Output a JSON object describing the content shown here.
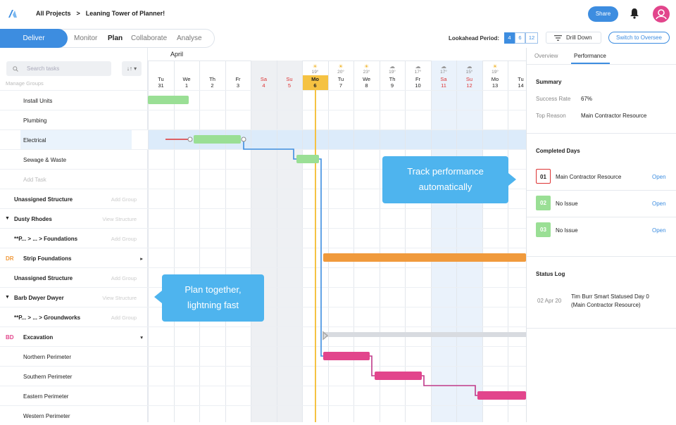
{
  "breadcrumb": {
    "root": "All Projects",
    "sep": ">",
    "project": "Leaning Tower of Planner!"
  },
  "header": {
    "share": "Share",
    "bell_icon": "bell-icon",
    "avatar_icon": "user-avatar-icon"
  },
  "nav": {
    "deliver": "Deliver",
    "monitor": "Monitor",
    "plan": "Plan",
    "collaborate": "Collaborate",
    "analyse": "Analyse"
  },
  "toolbar": {
    "lookahead_label": "Lookahead Period:",
    "periods": [
      "4",
      "6",
      "12"
    ],
    "drill": "Drill Down",
    "switch": "Switch to Oversee"
  },
  "left": {
    "search_placeholder": "Search tasks",
    "sort": "↓↑ ▾",
    "manage": "Manage Groups",
    "rows": [
      {
        "text": "Install Units",
        "action": ""
      },
      {
        "text": "Plumbing",
        "action": ""
      },
      {
        "text": "Electrical",
        "action": ""
      },
      {
        "text": "Sewage & Waste",
        "action": ""
      },
      {
        "text": "Add Task",
        "action": ""
      },
      {
        "text": "Unassigned Structure",
        "action": "Add Group"
      },
      {
        "text": "Dusty Rhodes",
        "action": "View Structure"
      },
      {
        "text": "**P... > ... > Foundations",
        "action": "Add Group"
      },
      {
        "text": "Strip Foundations",
        "action": "▸",
        "tag": "DR"
      },
      {
        "text": "Unassigned Structure",
        "action": "Add Group"
      },
      {
        "text": "Barb Dwyer Dwyer",
        "action": "View Structure"
      },
      {
        "text": "**P... > ... > Groundworks",
        "action": "Add Group"
      },
      {
        "text": "Excavation",
        "action": "▾",
        "tag": "BD"
      },
      {
        "text": "Northern Perimeter",
        "action": ""
      },
      {
        "text": "Southern Perimeter",
        "action": ""
      },
      {
        "text": "Eastern Perimeter",
        "action": ""
      },
      {
        "text": "Western Perimeter",
        "action": ""
      }
    ]
  },
  "timeline": {
    "month": "April",
    "days": [
      {
        "d": "Tu",
        "n": "31",
        "w": ""
      },
      {
        "d": "We",
        "n": "1",
        "w": ""
      },
      {
        "d": "Th",
        "n": "2",
        "w": ""
      },
      {
        "d": "Fr",
        "n": "3",
        "w": ""
      },
      {
        "d": "Sa",
        "n": "4",
        "w": ""
      },
      {
        "d": "Su",
        "n": "5",
        "w": ""
      },
      {
        "d": "Mo",
        "n": "6",
        "w": "19°"
      },
      {
        "d": "Tu",
        "n": "7",
        "w": "20°"
      },
      {
        "d": "We",
        "n": "8",
        "w": "23°"
      },
      {
        "d": "Th",
        "n": "9",
        "w": "19°"
      },
      {
        "d": "Fr",
        "n": "10",
        "w": "17°"
      },
      {
        "d": "Sa",
        "n": "11",
        "w": "17°"
      },
      {
        "d": "Su",
        "n": "12",
        "w": "15°"
      },
      {
        "d": "Mo",
        "n": "13",
        "w": "19°"
      },
      {
        "d": "Tu",
        "n": "14",
        "w": ""
      }
    ]
  },
  "callouts": {
    "track": "Track performance automatically",
    "plan": "Plan together, lightning fast"
  },
  "panel": {
    "tab1": "Overview",
    "tab2": "Performance",
    "summary": "Summary",
    "success_label": "Success Rate",
    "success": "67%",
    "reason_label": "Top Reason",
    "reason": "Main Contractor Resource",
    "completed": "Completed Days",
    "days": [
      {
        "n": "01",
        "text": "Main Contractor Resource",
        "open": "Open"
      },
      {
        "n": "02",
        "text": "No Issue",
        "open": "Open"
      },
      {
        "n": "03",
        "text": "No Issue",
        "open": "Open"
      }
    ],
    "log": "Status Log",
    "log_date": "02 Apr 20",
    "log_text1": "Tim Burr Smart Statused Day 0",
    "log_text2": "(Main Contractor Resource)"
  },
  "colors": {
    "accent": "#3d8de0",
    "green": "#9adf95",
    "orange": "#f09a3c",
    "pink": "#e2458c",
    "today": "#f5c242",
    "callout": "#4eb4ee"
  }
}
